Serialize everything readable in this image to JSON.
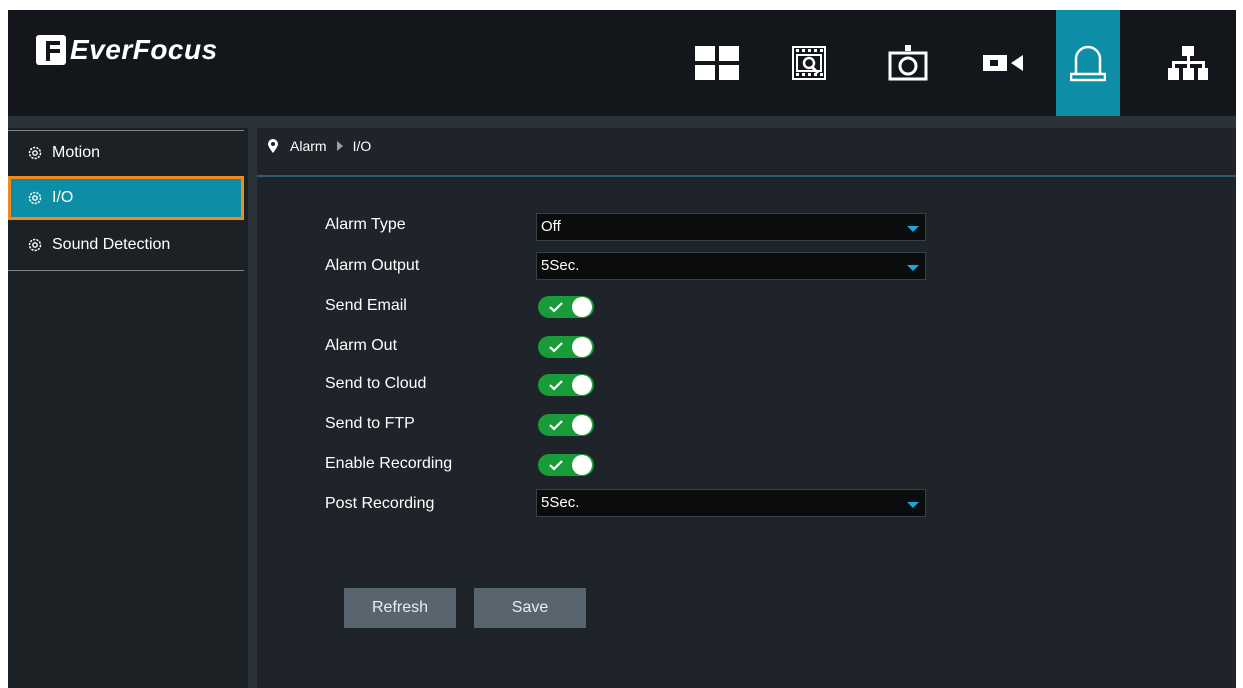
{
  "header": {
    "logo_text": "EverFocus",
    "nav": [
      {
        "name": "live-view",
        "icon": "grid-layout-icon",
        "active": false
      },
      {
        "name": "playback",
        "icon": "video-search-icon",
        "active": false
      },
      {
        "name": "snapshot",
        "icon": "camera-frame-icon",
        "active": false
      },
      {
        "name": "camera",
        "icon": "video-camera-icon",
        "active": false
      },
      {
        "name": "alarm",
        "icon": "alarm-bell-icon",
        "active": true
      },
      {
        "name": "network",
        "icon": "network-tree-icon",
        "active": false
      }
    ],
    "accent_color": "#0d8ea6"
  },
  "sidebar": {
    "items": [
      {
        "label": "Motion",
        "icon": "gear-icon",
        "selected": false
      },
      {
        "label": "I/O",
        "icon": "gear-icon",
        "selected": true
      },
      {
        "label": "Sound Detection",
        "icon": "gear-icon",
        "selected": false
      }
    ],
    "highlight_color": "#f08a1c"
  },
  "breadcrumb": {
    "icon": "location-pin-icon",
    "items": [
      "Alarm",
      "I/O"
    ]
  },
  "form": {
    "alarm_type": {
      "label": "Alarm Type",
      "value": "Off"
    },
    "alarm_output": {
      "label": "Alarm Output",
      "value": "5Sec."
    },
    "send_email": {
      "label": "Send Email",
      "on": true
    },
    "alarm_out": {
      "label": "Alarm Out",
      "on": true
    },
    "send_to_cloud": {
      "label": "Send to Cloud",
      "on": true
    },
    "send_to_ftp": {
      "label": "Send to FTP",
      "on": true
    },
    "enable_recording": {
      "label": "Enable Recording",
      "on": true
    },
    "post_recording": {
      "label": "Post Recording",
      "value": "5Sec."
    }
  },
  "buttons": {
    "refresh": "Refresh",
    "save": "Save"
  },
  "toggle_color": "#1a9b3a"
}
